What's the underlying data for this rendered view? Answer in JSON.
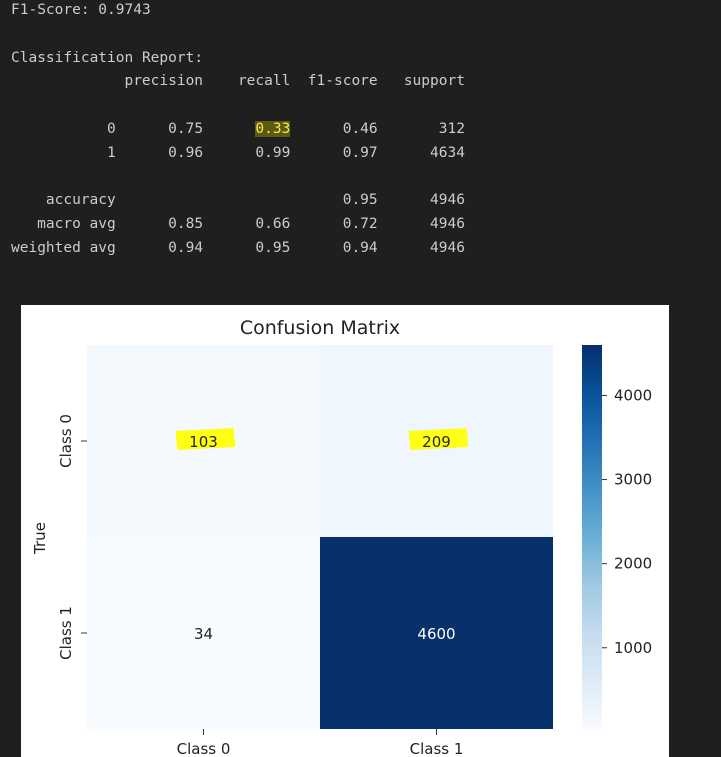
{
  "output": {
    "f1_line": "F1-Score: 0.9743",
    "report_title": "Classification Report:",
    "header": [
      "precision",
      "recall",
      "f1-score",
      "support"
    ],
    "rows": [
      {
        "label": "0",
        "values": [
          "0.75",
          "0.33",
          "0.46",
          "312"
        ]
      },
      {
        "label": "1",
        "values": [
          "0.96",
          "0.99",
          "0.97",
          "4634"
        ]
      },
      {
        "label": "accuracy",
        "values": [
          "",
          "",
          "0.95",
          "4946"
        ]
      },
      {
        "label": "macro avg",
        "values": [
          "0.85",
          "0.66",
          "0.72",
          "4946"
        ]
      },
      {
        "label": "weighted avg",
        "values": [
          "0.94",
          "0.95",
          "0.94",
          "4946"
        ]
      }
    ],
    "highlight_color": "#ffe84d"
  },
  "chart_data": {
    "type": "heatmap",
    "title": "Confusion Matrix",
    "ylabel": "True",
    "xlabel": "",
    "y_categories": [
      "Class 0",
      "Class 1"
    ],
    "x_categories": [
      "Class 0",
      "Class 1"
    ],
    "values": [
      [
        103,
        209
      ],
      [
        34,
        4600
      ]
    ],
    "colormap": "Blues",
    "color_range": [
      34,
      4600
    ],
    "colorbar_ticks": [
      1000,
      2000,
      3000,
      4000
    ],
    "highlighted_cells": [
      "103",
      "209"
    ],
    "highlight_color": "#ffff00"
  }
}
